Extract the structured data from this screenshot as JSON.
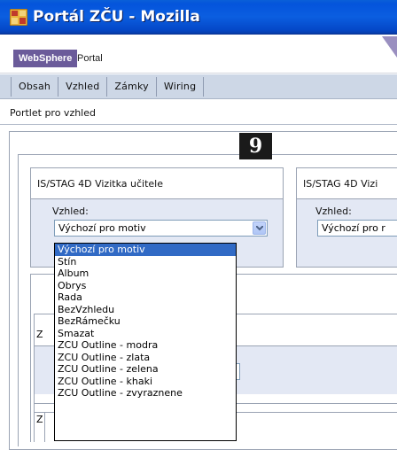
{
  "window": {
    "title": "Portál ZČU - Mozilla"
  },
  "brand": {
    "logo_text": "WebSphere",
    "product_text": "Portal"
  },
  "tabs": [
    {
      "label": "Obsah"
    },
    {
      "label": "Vzhled"
    },
    {
      "label": "Zámky"
    },
    {
      "label": "Wiring"
    }
  ],
  "page": {
    "portlet_title": "Portlet pro vzhled",
    "badge_number": "9"
  },
  "portlets": [
    {
      "title": "IS/STAG 4D Vizitka učitele",
      "skin_label": "Vzhled:",
      "selected_skin": "Výchozí pro motiv"
    },
    {
      "title": "IS/STAG 4D Vizi",
      "skin_label": "Vzhled:",
      "selected_skin": "Výchozí pro r"
    }
  ],
  "lower": {
    "z_label_1": "Z",
    "z_label_2": "Z"
  },
  "dropdown": {
    "options": [
      "Výchozí pro motiv",
      "Stín",
      "Album",
      "Obrys",
      "Rada",
      "BezVzhledu",
      "BezRámečku",
      "Smazat",
      "ZCU Outline - modra",
      "ZCU Outline - zlata",
      "ZCU Outline - zelena",
      "ZCU Outline - khaki",
      "ZCU Outline - zvyraznene"
    ],
    "selected_index": 0
  },
  "colors": {
    "titlebar": "#0454dc",
    "tabbar": "#cdd7e6",
    "panel": "#e3e8f4",
    "selection": "#316ac5",
    "brand": "#6b5b9a"
  }
}
